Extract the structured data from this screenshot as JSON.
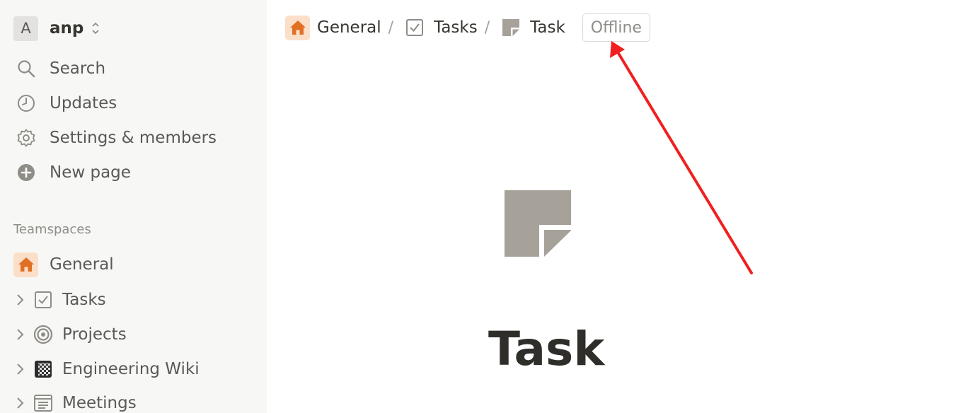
{
  "workspace": {
    "avatar_letter": "A",
    "name": "anp"
  },
  "nav": {
    "items": [
      {
        "label": "Search",
        "icon": "search-icon"
      },
      {
        "label": "Updates",
        "icon": "clock-icon"
      },
      {
        "label": "Settings & members",
        "icon": "gear-icon"
      },
      {
        "label": "New page",
        "icon": "plus-circle-icon"
      }
    ]
  },
  "teamspaces": {
    "title": "Teamspaces",
    "team": {
      "label": "General",
      "icon": "home-icon"
    },
    "pages": [
      {
        "label": "Tasks",
        "icon": "checkbox-icon"
      },
      {
        "label": "Projects",
        "icon": "target-icon"
      },
      {
        "label": "Engineering Wiki",
        "icon": "notebook-icon"
      },
      {
        "label": "Meetings",
        "icon": "document-icon"
      }
    ]
  },
  "breadcrumb": [
    {
      "label": "General",
      "icon": "home-icon"
    },
    {
      "label": "Tasks",
      "icon": "checkbox-icon"
    },
    {
      "label": "Task",
      "icon": "page-icon"
    }
  ],
  "breadcrumb_separator": "/",
  "status_badge": "Offline",
  "page": {
    "title": "Task",
    "icon": "page-icon"
  },
  "colors": {
    "sidebar_bg": "#f7f7f5",
    "home_badge_bg": "#fbdfc9",
    "home_icon": "#e16f24",
    "annotation_arrow": "#f02020"
  }
}
